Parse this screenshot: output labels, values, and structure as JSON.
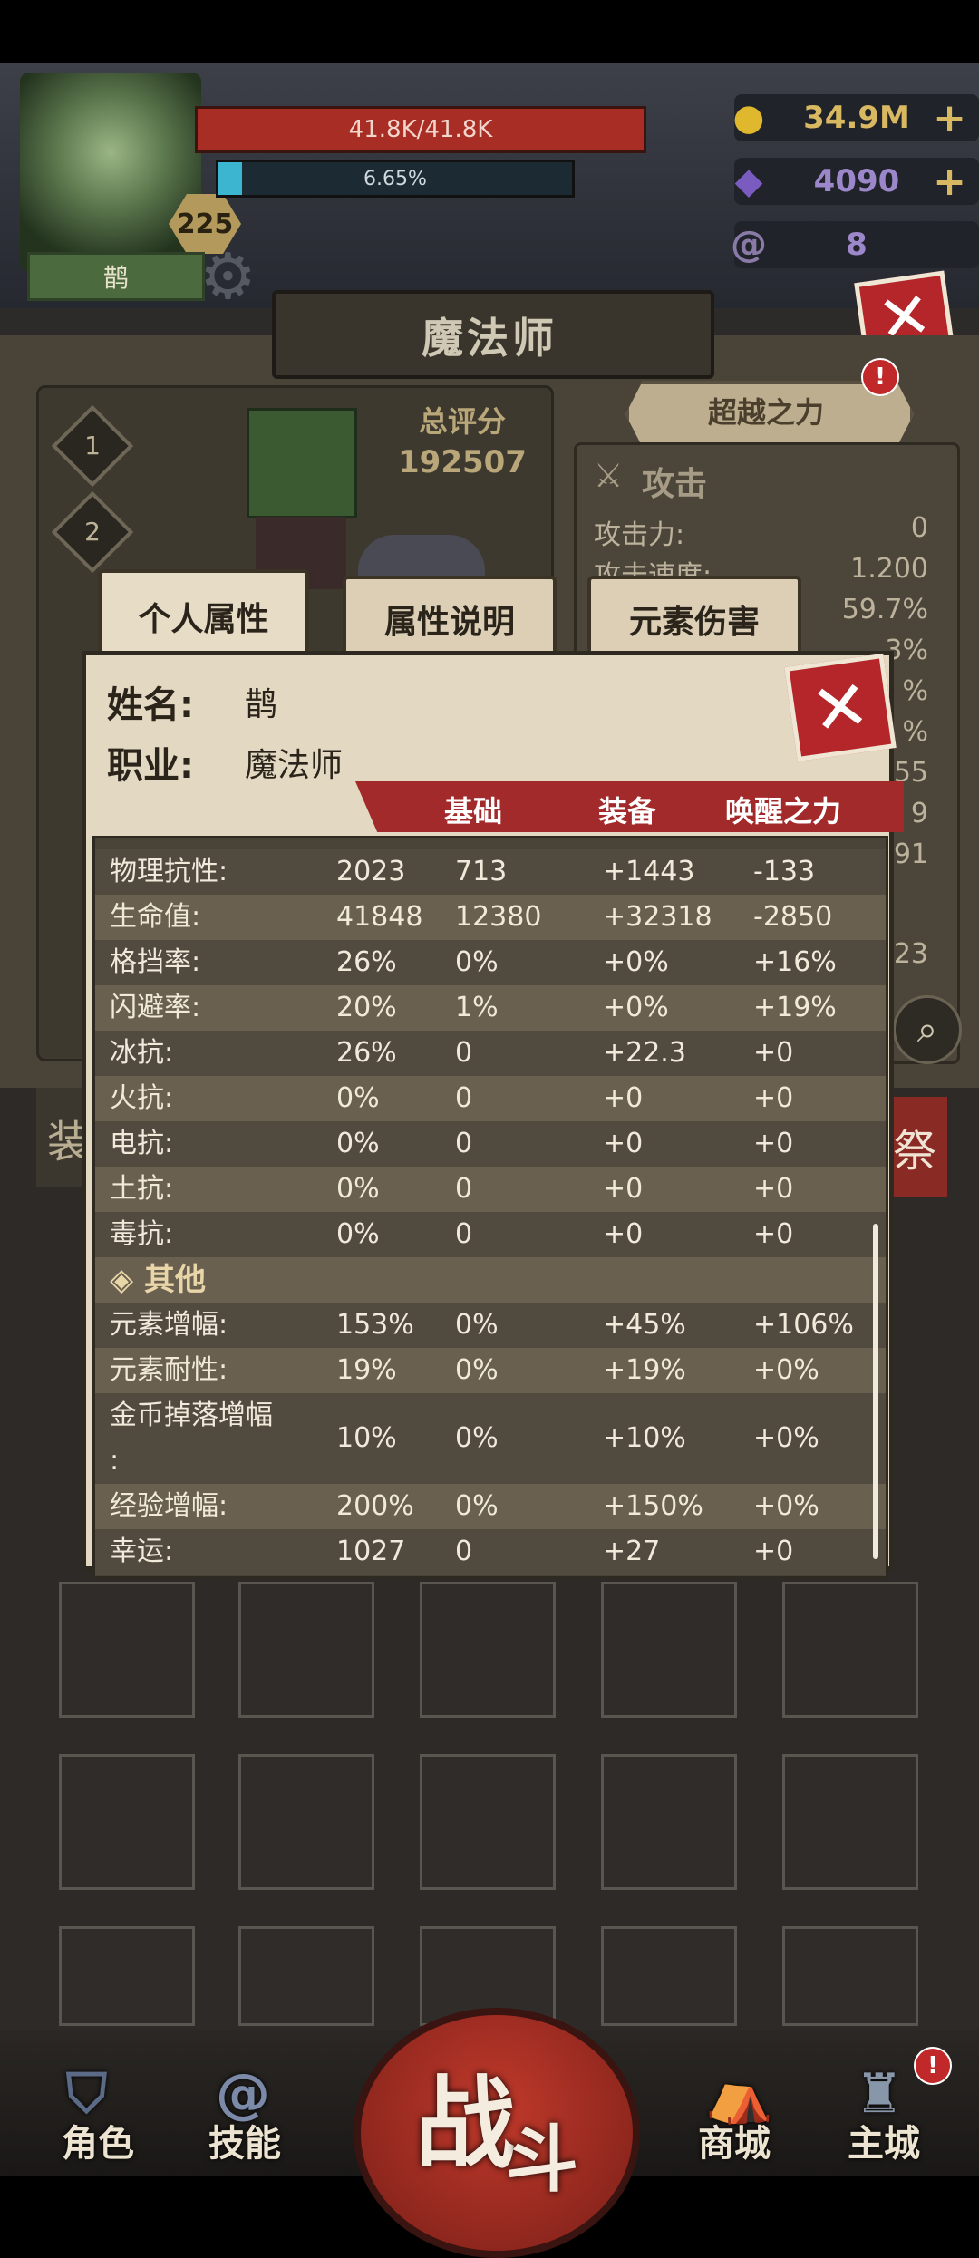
{
  "player": {
    "name": "鹊",
    "level": "225",
    "hp": "41.8K/41.8K",
    "xp": "6.65%",
    "xp_fraction": 0.0665
  },
  "resources": [
    {
      "icon": "gold-coin-icon",
      "value": "34.9M",
      "plus": "+"
    },
    {
      "icon": "purple-gem-icon",
      "value": "4090",
      "plus": "+"
    },
    {
      "icon": "ram-horn-icon",
      "value": "8"
    }
  ],
  "screen_title": "魔法师",
  "score": {
    "label": "总评分",
    "value": "192507"
  },
  "slots": [
    "1",
    "2"
  ],
  "transcend": {
    "label": "超越之力",
    "badge": "!"
  },
  "attack_panel": {
    "header": "攻击",
    "rows": [
      {
        "label": "攻击力:",
        "value": "0"
      },
      {
        "label": "攻击速度:",
        "value": "1.200"
      }
    ],
    "peek_values": [
      "59.7%",
      "3%",
      "%",
      "%",
      "55",
      "9",
      "91",
      "23"
    ]
  },
  "tabs": [
    "个人属性",
    "属性说明",
    "元素伤害"
  ],
  "detail": {
    "name_label": "姓名:",
    "name_value": "鹊",
    "job_label": "职业:",
    "job_value": "魔法师",
    "columns": [
      "基础",
      "装备",
      "唤醒之力"
    ],
    "rows": [
      {
        "label": "物理抗性:",
        "total": "2023",
        "base": "713",
        "equip": "+1443",
        "awaken": "-133"
      },
      {
        "label": "生命值:",
        "total": "41848",
        "base": "12380",
        "equip": "+32318",
        "awaken": "-2850"
      },
      {
        "label": "格挡率:",
        "total": "26%",
        "base": "0%",
        "equip": "+0%",
        "awaken": "+16%"
      },
      {
        "label": "闪避率:",
        "total": "20%",
        "base": "1%",
        "equip": "+0%",
        "awaken": "+19%"
      },
      {
        "label": "冰抗:",
        "total": "26%",
        "base": "0",
        "equip": "+22.3",
        "awaken": "+0"
      },
      {
        "label": "火抗:",
        "total": "0%",
        "base": "0",
        "equip": "+0",
        "awaken": "+0"
      },
      {
        "label": "电抗:",
        "total": "0%",
        "base": "0",
        "equip": "+0",
        "awaken": "+0"
      },
      {
        "label": "土抗:",
        "total": "0%",
        "base": "0",
        "equip": "+0",
        "awaken": "+0"
      },
      {
        "label": "毒抗:",
        "total": "0%",
        "base": "0",
        "equip": "+0",
        "awaken": "+0"
      }
    ],
    "section_other": "◈ 其他",
    "other_rows": [
      {
        "label": "元素增幅:",
        "total": "153%",
        "base": "0%",
        "equip": "+45%",
        "awaken": "+106%"
      },
      {
        "label": "元素耐性:",
        "total": "19%",
        "base": "0%",
        "equip": "+19%",
        "awaken": "+0%"
      },
      {
        "label": "金币掉落增幅",
        "label2": ":",
        "total": "10%",
        "base": "0%",
        "equip": "+10%",
        "awaken": "+0%"
      },
      {
        "label": "经验增幅:",
        "total": "200%",
        "base": "0%",
        "equip": "+150%",
        "awaken": "+0%"
      },
      {
        "label": "幸运:",
        "total": "1027",
        "base": "0",
        "equip": "+27",
        "awaken": "+0"
      }
    ]
  },
  "side_peek": {
    "left": "装",
    "right": "祭"
  },
  "nav": {
    "role": "角色",
    "skill": "技能",
    "battle_1": "战",
    "battle_2": "斗",
    "shop": "商城",
    "city": "主城",
    "city_badge": "!"
  }
}
